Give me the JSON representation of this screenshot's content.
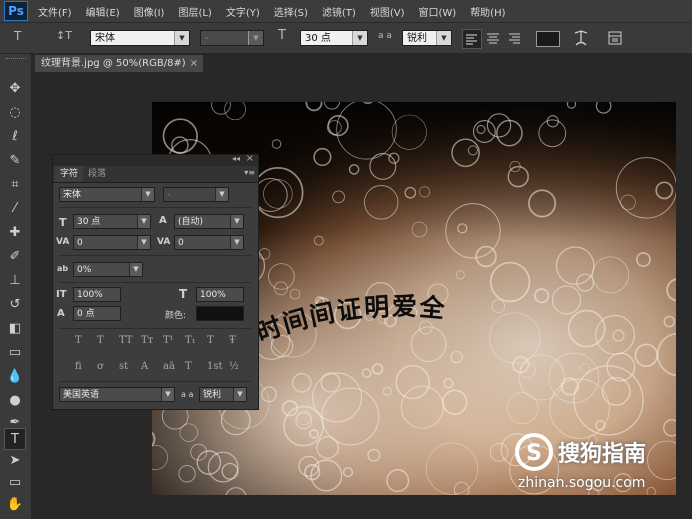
{
  "app": {
    "logo": "Ps"
  },
  "menu": [
    "文件(F)",
    "编辑(E)",
    "图像(I)",
    "图层(L)",
    "文字(Y)",
    "选择(S)",
    "滤镜(T)",
    "视图(V)",
    "窗口(W)",
    "帮助(H)"
  ],
  "options_bar": {
    "tool_icon": "T",
    "orient_icon": "↕T",
    "font_family": "宋体",
    "font_style": "-",
    "size_icon": "T",
    "font_size": "30 点",
    "aa_icon": "a a",
    "antialias": "锐利",
    "text_color": "#1a1a1a"
  },
  "document_tab": {
    "title": "纹理背景.jpg @ 50%(RGB/8#)",
    "close": "×"
  },
  "canvas": {
    "curved_text": "时间间证明爱全"
  },
  "character_panel": {
    "tabs": [
      "字符",
      "段落"
    ],
    "collapse_icon": "◂◂",
    "close_icon": "×",
    "menu_icon": "▾≡",
    "font_family": "宋体",
    "font_style": "-",
    "font_size": "30 点",
    "leading": "(自动)",
    "kerning": "0",
    "tracking": "0",
    "scale_ratio": "0%",
    "vertical_scale": "100%",
    "horizontal_scale": "100%",
    "baseline_shift": "0 点",
    "color_label": "颜色:",
    "color_value": "#111111",
    "language": "美国英语",
    "aa_label": "a a",
    "antialias": "锐利",
    "style_buttons_row1": [
      "T",
      "T",
      "TT",
      "Tт",
      "T¹",
      "T₁",
      "T",
      "Ŧ"
    ],
    "style_buttons_row2": [
      "fi",
      "ơ",
      "st",
      "A",
      "aā",
      "T",
      "1st",
      "½"
    ],
    "icons": {
      "size": "T",
      "leading": "A",
      "kerning": "VA",
      "tracking": "VA",
      "scale": "ab",
      "vscale": "IT",
      "hscale": "T",
      "baseline": "A"
    }
  },
  "watermark": {
    "brand": "搜狗指南",
    "url": "zhinan.sogou.com"
  },
  "colors": {
    "accent": "#4aa3ff",
    "panel": "#3d3d3d",
    "bar": "#3a3a3a"
  }
}
